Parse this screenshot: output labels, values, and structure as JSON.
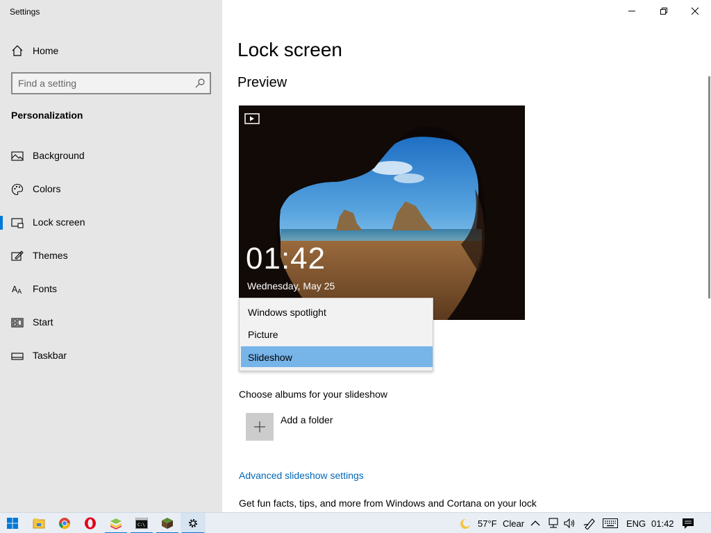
{
  "window": {
    "title": "Settings",
    "controls": {
      "minimize_icon": "minimize-icon",
      "restore_icon": "restore-icon",
      "close_icon": "close-icon"
    }
  },
  "sidebar": {
    "home_label": "Home",
    "search_placeholder": "Find a setting",
    "section_title": "Personalization",
    "items": [
      {
        "label": "Background",
        "icon": "picture-icon",
        "active": false
      },
      {
        "label": "Colors",
        "icon": "palette-icon",
        "active": false
      },
      {
        "label": "Lock screen",
        "icon": "lock-screen-icon",
        "active": true
      },
      {
        "label": "Themes",
        "icon": "themes-icon",
        "active": false
      },
      {
        "label": "Fonts",
        "icon": "fonts-icon",
        "active": false
      },
      {
        "label": "Start",
        "icon": "start-icon",
        "active": false
      },
      {
        "label": "Taskbar",
        "icon": "taskbar-icon",
        "active": false
      }
    ]
  },
  "main": {
    "page_title": "Lock screen",
    "preview_heading": "Preview",
    "preview": {
      "time": "01:42",
      "date": "Wednesday, May 25"
    },
    "dropdown": {
      "options": [
        "Windows spotlight",
        "Picture",
        "Slideshow"
      ],
      "selected": "Slideshow"
    },
    "albums_label": "Choose albums for your slideshow",
    "add_folder_label": "Add a folder",
    "advanced_link": "Advanced slideshow settings",
    "fun_facts_text": "Get fun facts, tips, and more from Windows and Cortana on your lock"
  },
  "taskbar": {
    "apps": [
      "start-icon",
      "file-explorer-icon",
      "chrome-icon",
      "opera-icon",
      "bluestacks-icon",
      "command-prompt-icon",
      "minecraft-icon",
      "settings-icon"
    ],
    "weather": {
      "temp": "57°F",
      "condition": "Clear"
    },
    "language": "ENG",
    "time": "01:42"
  },
  "colors": {
    "accent": "#0078d7",
    "link": "#0067b8",
    "selected_option": "#77b4e8",
    "sidebar_bg": "#e6e6e6"
  }
}
